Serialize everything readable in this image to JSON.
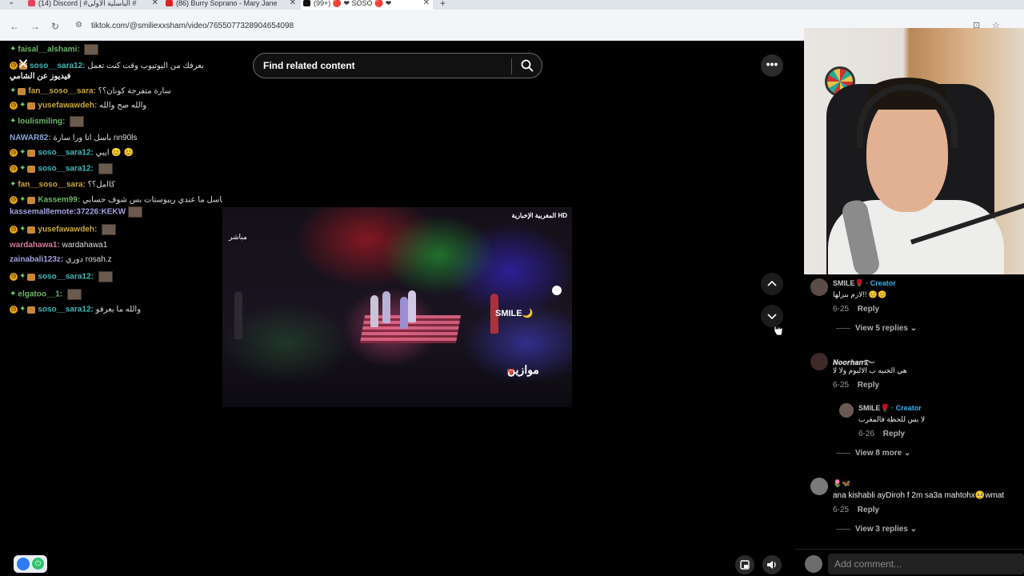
{
  "browser": {
    "tabs": [
      {
        "title": "(14) Discord | #الباسلية الأولى #",
        "icon_color": "#e8425c"
      },
      {
        "title": "(86) Burry Soprano - Mary Jane",
        "icon_color": "#e02020"
      },
      {
        "title": "(99+) 🔴 ❤ SOSO 🔴 ❤",
        "icon_color": "#111111"
      }
    ],
    "new_tab_label": "+",
    "url": "tiktok.com/@smiliexxsham/video/7655077328904654098"
  },
  "chat": {
    "messages": [
      {
        "user": "faisal__alshami:",
        "user_style": "u-green",
        "badges": "g",
        "text": "",
        "emote": true
      },
      {
        "user": "soso__sara12:",
        "user_style": "u-teal",
        "badges": "ob",
        "text": "بعرفك من اليوتيوب وقت كنت تعمل",
        "emote": false
      },
      {
        "user": "",
        "user_style": "u-white",
        "badges": "",
        "text": "فيديوز عن الشامي",
        "emote": false
      },
      {
        "user": "fan__soso__sara:",
        "user_style": "u-gold",
        "badges": "gb",
        "text": "سارة متفرجة كونان؟؟",
        "emote": false
      },
      {
        "user": "yusefawawdeh:",
        "user_style": "u-gold",
        "badges": "ogb",
        "text": "والله صح والله",
        "emote": false
      },
      {
        "user": "loulismiling:",
        "user_style": "u-green",
        "badges": "g",
        "text": "",
        "emote": true
      },
      {
        "user": "NAWAR82:",
        "user_style": "u-blue",
        "badges": "",
        "text": "باسل انا ورا سارة nn90ls",
        "emote": false
      },
      {
        "user": "soso__sara12:",
        "user_style": "u-teal",
        "badges": "ogb",
        "text": "ايبي 😊 😊",
        "emote": false
      },
      {
        "user": "soso__sara12:",
        "user_style": "u-teal",
        "badges": "ogb",
        "text": "",
        "emote": true
      },
      {
        "user": "fan__soso__sara:",
        "user_style": "u-gold",
        "badges": "g",
        "text": "كاامل؟؟",
        "emote": false
      },
      {
        "user": "Kassem99:",
        "user_style": "u-green",
        "badges": "ogb",
        "text": "باسل ما عندي ريبوستات بس شوف حسابي",
        "emote": false
      },
      {
        "user": "",
        "user_style": "u-lav",
        "badges": "",
        "text": "kassemal8emote:37226:KEKW",
        "emote": true
      },
      {
        "user": "yusefawawdeh:",
        "user_style": "u-gold",
        "badges": "ogb",
        "text": "",
        "emote": true
      },
      {
        "user": "wardahawa1:",
        "user_style": "u-pink",
        "badges": "",
        "text": "wardahawa1",
        "emote": false
      },
      {
        "user": "zainabali123z:",
        "user_style": "u-lav",
        "badges": "",
        "text": "دوري rosah.z",
        "emote": false
      },
      {
        "user": "soso__sara12:",
        "user_style": "u-teal",
        "badges": "ogb",
        "text": "",
        "emote": true
      },
      {
        "user": "elgatoo__1:",
        "user_style": "u-green",
        "badges": "g",
        "text": "",
        "emote": true
      },
      {
        "user": "soso__sara12:",
        "user_style": "u-teal",
        "badges": "ogb",
        "text": "والله ما بعرفو",
        "emote": false
      }
    ],
    "close_label": "✕"
  },
  "main": {
    "search_placeholder": "Find related content",
    "video": {
      "live_label": "مباشر",
      "channel_logo": "المغربية الإخبارية HD",
      "watermark": "SMILE🌙",
      "brand": "موازين"
    },
    "more_label": "•••"
  },
  "comments": [
    {
      "name": "SMILE🌹",
      "creator_label": "· Creator",
      "text": "لازم بنزلها!! 😊😊",
      "date": "6-25",
      "reply_label": "Reply",
      "view_replies": "View 5 replies"
    },
    {
      "name": "𝑵𝒐𝒐𝒓𝒉𝒂𝒏࿐",
      "creator_label": "",
      "text": "هي الخنيه ب الالبوم ولا لا",
      "date": "6-25",
      "reply_label": "Reply",
      "view_replies": ""
    },
    {
      "name": "SMILE🌹",
      "creator_label": "· Creator",
      "text": "لا بس للحظة فالمغرب",
      "date": "6-26",
      "reply_label": "Reply",
      "view_replies": "View 8 more"
    },
    {
      "name": "🌷🦋",
      "creator_label": "",
      "text": "ana kishabli ayDiroh f 2m sa3a mahtohx🥺wmat",
      "date": "6-25",
      "reply_label": "Reply",
      "view_replies": "View 3 replies"
    }
  ],
  "add_comment_placeholder": "Add comment...",
  "colors": {
    "creator": "#3fb3f0",
    "background": "#000000"
  }
}
